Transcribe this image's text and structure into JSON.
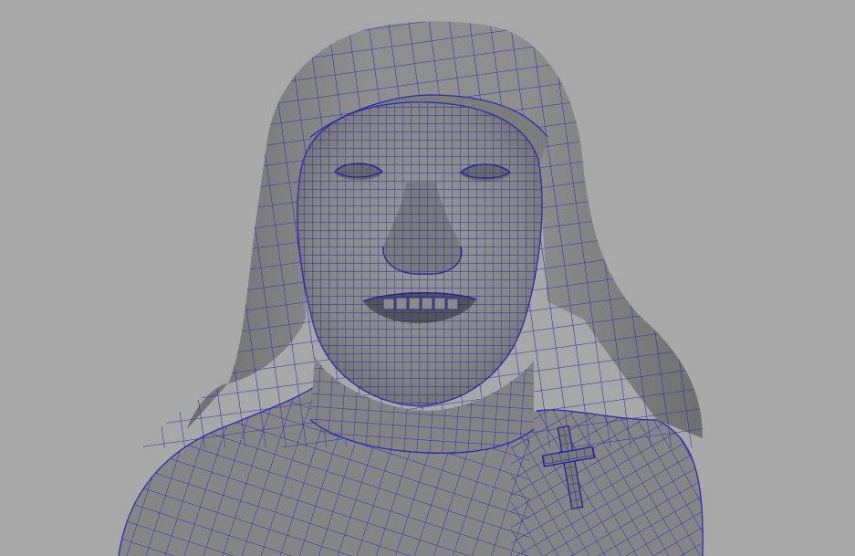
{
  "viewport": {
    "background_color": "#a8a8a8",
    "mesh_fill_color": "#8b8b8b",
    "mesh_shadow_color": "#6f6f6f",
    "mesh_highlight_color": "#9a9a9a",
    "wireframe_color": "#2b2bb0",
    "wireframe_dense_color": "#1f1fa0",
    "display_mode": "wireframe-on-shaded"
  },
  "model": {
    "icon": "polygon-mesh-bust-icon",
    "parts": [
      "veil",
      "face",
      "eyes",
      "nose",
      "mouth",
      "neck",
      "robe",
      "cross-pin"
    ]
  }
}
